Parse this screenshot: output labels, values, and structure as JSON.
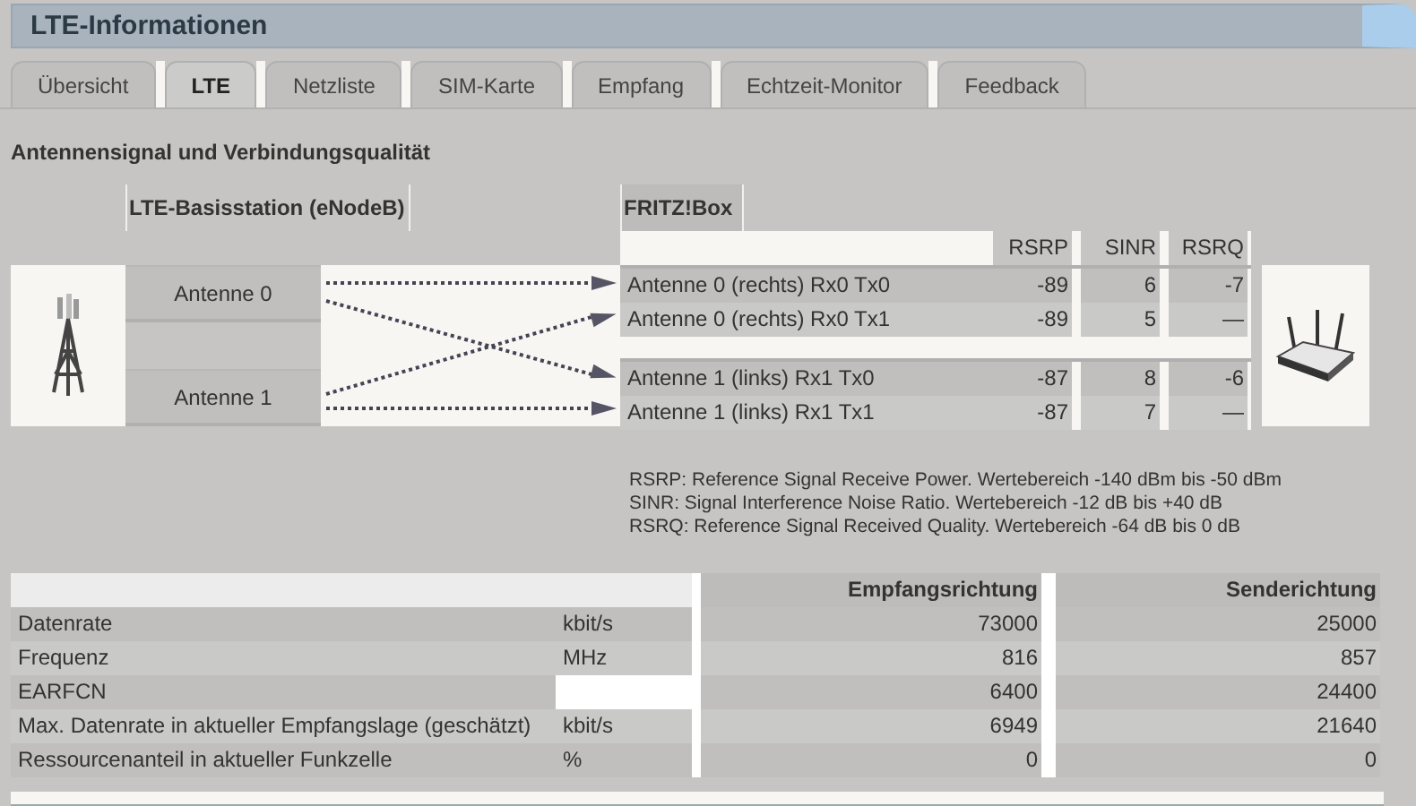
{
  "window": {
    "title": "LTE-Informationen"
  },
  "tabs": [
    {
      "label": "Übersicht",
      "selected": false
    },
    {
      "label": "LTE",
      "selected": true
    },
    {
      "label": "Netzliste",
      "selected": false
    },
    {
      "label": "SIM-Karte",
      "selected": false
    },
    {
      "label": "Empfang",
      "selected": false
    },
    {
      "label": "Echtzeit-Monitor",
      "selected": false
    },
    {
      "label": "Feedback",
      "selected": false
    }
  ],
  "section": {
    "heading": "Antennensignal und Verbindungsqualität"
  },
  "diagram": {
    "base_station_heading": "LTE-Basisstation (eNodeB)",
    "device_heading": "FRITZ!Box",
    "metric_columns": [
      "RSRP",
      "SINR",
      "RSRQ"
    ],
    "base_antennas": [
      "Antenne 0",
      "Antenne 1"
    ],
    "groups": [
      {
        "rows": [
          {
            "label": "Antenne 0 (rechts) Rx0 Tx0",
            "rsrp": "-89",
            "sinr": "6",
            "rsrq": "-7"
          },
          {
            "label": "Antenne 0 (rechts) Rx0 Tx1",
            "rsrp": "-89",
            "sinr": "5",
            "rsrq": "—"
          }
        ]
      },
      {
        "rows": [
          {
            "label": "Antenne 1 (links) Rx1 Tx0",
            "rsrp": "-87",
            "sinr": "8",
            "rsrq": "-6"
          },
          {
            "label": "Antenne 1 (links) Rx1 Tx1",
            "rsrp": "-87",
            "sinr": "7",
            "rsrq": "—"
          }
        ]
      }
    ]
  },
  "legend": [
    "RSRP: Reference Signal Receive Power. Wertebereich -140 dBm bis -50 dBm",
    "SINR: Signal Interference Noise Ratio. Wertebereich -12 dB bis +40 dB",
    "RSRQ: Reference Signal Received Quality. Wertebereich -64 dB bis 0 dB"
  ],
  "table": {
    "columns": [
      "Empfangsrichtung",
      "Senderichtung"
    ],
    "rows": [
      {
        "label": "Datenrate",
        "unit": "kbit/s",
        "rx": "73000",
        "tx": "25000"
      },
      {
        "label": "Frequenz",
        "unit": "MHz",
        "rx": "816",
        "tx": "857"
      },
      {
        "label": "EARFCN",
        "rx": "6400",
        "tx": "24400"
      },
      {
        "label": "Max. Datenrate in aktueller Empfangslage (geschätzt)",
        "unit": "kbit/s",
        "rx": "6949",
        "tx": "21640"
      },
      {
        "label": "Ressourcenanteil in aktueller Funkzelle",
        "unit": "%",
        "rx": "0",
        "tx": "0"
      }
    ]
  }
}
